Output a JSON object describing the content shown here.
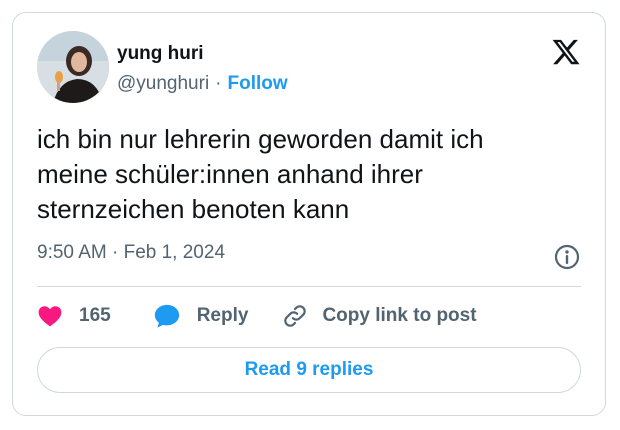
{
  "author": {
    "name": "yung huri",
    "handle": "@yunghuri",
    "separator": "·",
    "follow_label": "Follow"
  },
  "tweet": {
    "text": "ich bin nur lehrerin geworden damit ich\nmeine schüler:innen anhand ihrer\nsternzeichen benoten kann",
    "timestamp": "9:50 AM · Feb 1, 2024"
  },
  "actions": {
    "like_count": "165",
    "reply_label": "Reply",
    "copy_label": "Copy link to post"
  },
  "read_replies_label": "Read 9 replies",
  "icons": {
    "logo": "x-logo-icon",
    "info": "info-icon",
    "like": "heart-icon",
    "reply": "speech-bubble-icon",
    "copy": "link-icon"
  },
  "colors": {
    "accent": "#1d9bf0",
    "heart": "#f91880",
    "secondary_text": "#536471",
    "border": "#cfd9de"
  }
}
